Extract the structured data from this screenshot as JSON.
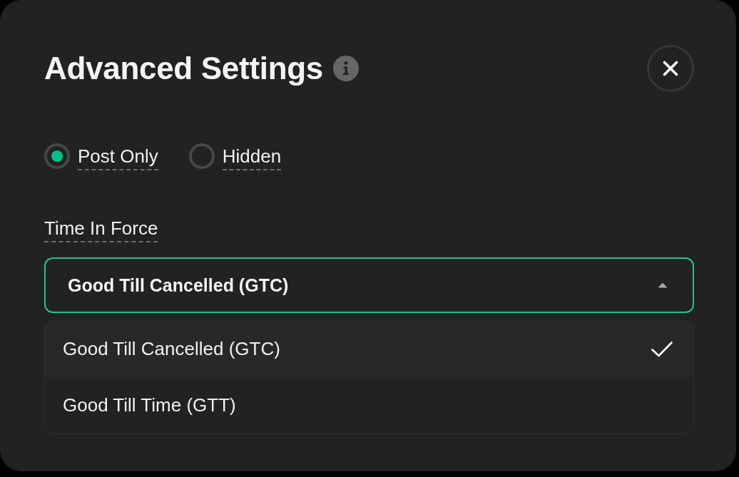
{
  "dialog": {
    "title": "Advanced Settings"
  },
  "options": [
    {
      "label": "Post Only",
      "selected": true
    },
    {
      "label": "Hidden",
      "selected": false
    }
  ],
  "time_in_force": {
    "label": "Time In Force",
    "value": "Good Till Cancelled (GTC)",
    "expanded": true,
    "items": [
      {
        "label": "Good Till Cancelled (GTC)",
        "selected": true
      },
      {
        "label": "Good Till Time (GTT)",
        "selected": false
      }
    ]
  }
}
